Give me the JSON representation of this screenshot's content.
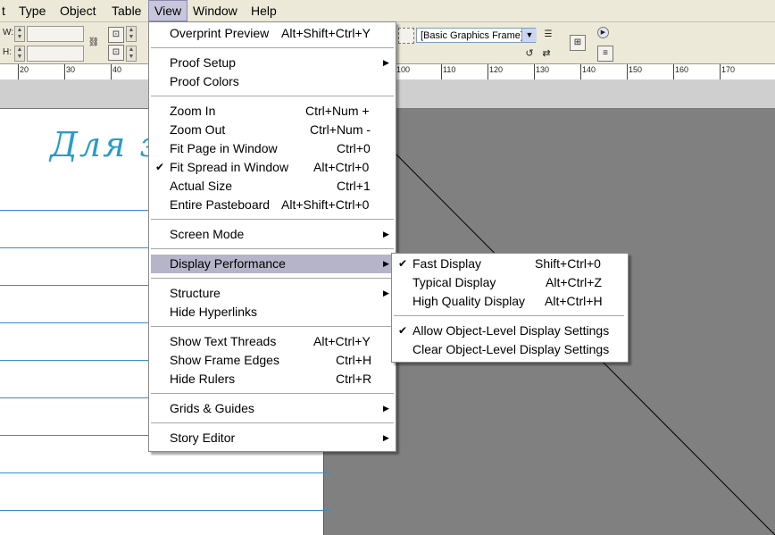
{
  "menubar": {
    "items": [
      {
        "label": "t",
        "left": 0
      },
      {
        "label": "Type"
      },
      {
        "label": "Object"
      },
      {
        "label": "Table"
      },
      {
        "label": "View"
      },
      {
        "label": "Window"
      },
      {
        "label": "Help"
      }
    ]
  },
  "toolbar": {
    "w_label": "W:",
    "h_label": "H:",
    "frame_select": "[Basic Graphics Frame]",
    "ruler_numbers": [
      "20",
      "30",
      "40",
      "100",
      "110",
      "120",
      "130",
      "140",
      "150",
      "160",
      "170"
    ]
  },
  "document": {
    "title_text": "Для за"
  },
  "view_menu": {
    "items": [
      {
        "label": "Overprint Preview",
        "shortcut": "Alt+Shift+Ctrl+Y"
      },
      {
        "label": "Proof Setup",
        "submenu": true
      },
      {
        "label": "Proof Colors"
      },
      {
        "label": "Zoom In",
        "shortcut": "Ctrl+Num +"
      },
      {
        "label": "Zoom Out",
        "shortcut": "Ctrl+Num -"
      },
      {
        "label": "Fit Page in Window",
        "shortcut": "Ctrl+0"
      },
      {
        "label": "Fit Spread in Window",
        "shortcut": "Alt+Ctrl+0",
        "checked": true
      },
      {
        "label": "Actual Size",
        "shortcut": "Ctrl+1"
      },
      {
        "label": "Entire Pasteboard",
        "shortcut": "Alt+Shift+Ctrl+0"
      },
      {
        "label": "Screen Mode",
        "submenu": true
      },
      {
        "label": "Display Performance",
        "submenu": true,
        "highlighted": true
      },
      {
        "label": "Structure",
        "submenu": true
      },
      {
        "label": "Hide Hyperlinks"
      },
      {
        "label": "Show Text Threads",
        "shortcut": "Alt+Ctrl+Y"
      },
      {
        "label": "Show Frame Edges",
        "shortcut": "Ctrl+H"
      },
      {
        "label": "Hide Rulers",
        "shortcut": "Ctrl+R"
      },
      {
        "label": "Grids & Guides",
        "submenu": true
      },
      {
        "label": "Story Editor",
        "submenu": true
      }
    ]
  },
  "display_submenu": {
    "items": [
      {
        "label": "Fast Display",
        "shortcut": "Shift+Ctrl+0",
        "checked": true
      },
      {
        "label": "Typical Display",
        "shortcut": "Alt+Ctrl+Z"
      },
      {
        "label": "High Quality Display",
        "shortcut": "Alt+Ctrl+H"
      },
      {
        "label": "Allow Object-Level Display Settings",
        "checked": true
      },
      {
        "label": "Clear Object-Level Display Settings"
      }
    ]
  },
  "colors": {
    "menu_highlight": "#b5b4c8",
    "pasteboard": "#808080",
    "guide_line": "#3a8cc4",
    "script_text": "#2a9bc9"
  }
}
